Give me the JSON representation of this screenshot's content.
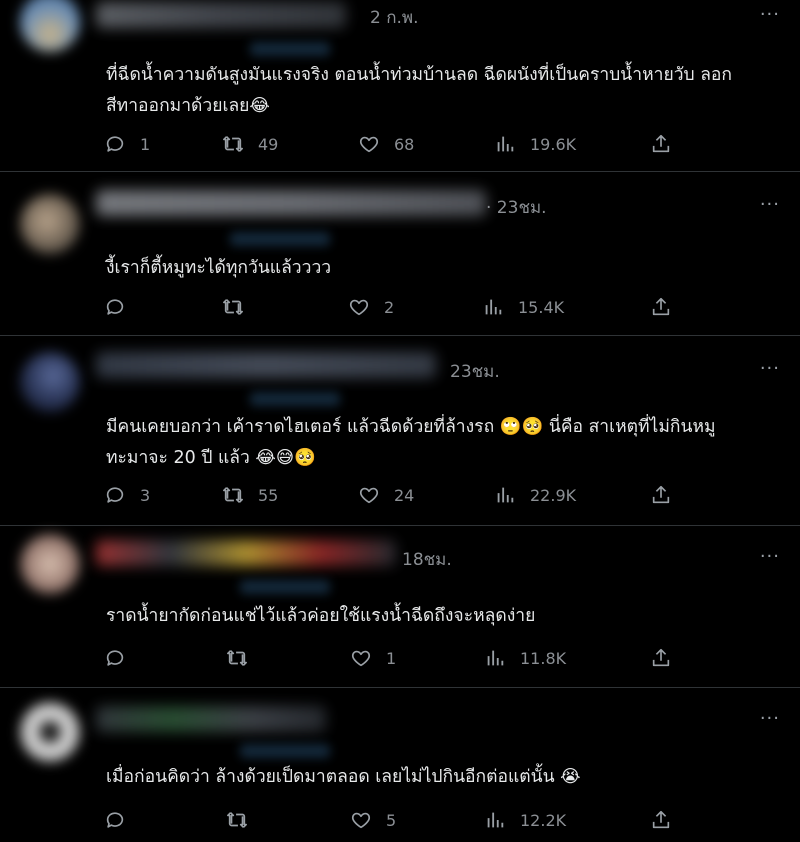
{
  "tweets": [
    {
      "time": "2 ก.พ.",
      "more": "···",
      "text": "ที่ฉีดน้ำความดันสูงมันแรงจริง ตอนน้ำท่วมบ้านลด ฉีดผนังที่เป็นคราบน้ำหายวับ ลอก\nสีทาออกมาด้วยเลย😂",
      "replies": "1",
      "retweets": "49",
      "likes": "68",
      "views": "19.6K"
    },
    {
      "time": "· 23ชม.",
      "more": "···",
      "text": "งี้เราก็ตี้หมูทะได้ทุกวันแล้วววว",
      "replies": "",
      "retweets": "",
      "likes": "2",
      "views": "15.4K"
    },
    {
      "time": "23ชม.",
      "more": "···",
      "text": "มีคนเคยบอกว่า เค้าราดไฮเตอร์ แล้วฉีดด้วยที่ล้างรถ 🙄🥺 นี่คือ สาเหตุที่ไม่กินหมู\nทะมาจะ 20 ปี แล้ว 😂😅🥺",
      "replies": "3",
      "retweets": "55",
      "likes": "24",
      "views": "22.9K"
    },
    {
      "time": "18ชม.",
      "more": "···",
      "text": "ราดน้ำยากัดก่อนแช่ไว้แล้วค่อยใช้แรงน้ำฉีดถึงจะหลุดง่าย",
      "replies": "",
      "retweets": "",
      "likes": "1",
      "views": "11.8K"
    },
    {
      "time": "",
      "more": "···",
      "text": "เมื่อก่อนคิดว่า ล้างด้วยเป็ดมาตลอด เลยไม่ไปกินอีกต่อแต่นั้น 😭",
      "replies": "",
      "retweets": "",
      "likes": "5",
      "views": "12.2K"
    }
  ],
  "colors": {
    "background": "#000000",
    "text": "#e7e9ea",
    "muted": "#8b8f94",
    "divider": "#2f3336"
  },
  "icons": [
    "reply-icon",
    "retweet-icon",
    "like-icon",
    "views-icon",
    "share-icon",
    "more-icon"
  ]
}
